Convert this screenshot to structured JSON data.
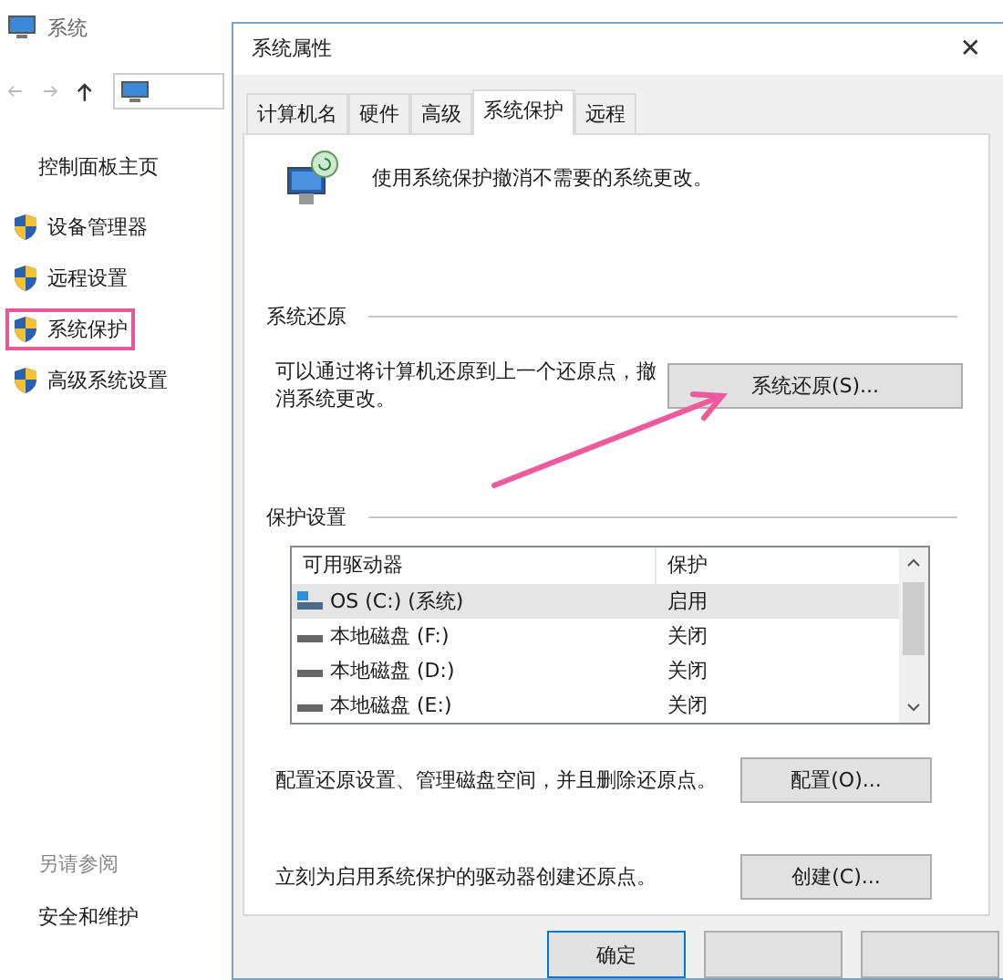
{
  "explorer": {
    "title": "系统",
    "home_link": "控制面板主页",
    "items": [
      {
        "label": "设备管理器",
        "highlighted": false
      },
      {
        "label": "远程设置",
        "highlighted": false
      },
      {
        "label": "系统保护",
        "highlighted": true
      },
      {
        "label": "高级系统设置",
        "highlighted": false
      }
    ],
    "see_also": {
      "heading": "另请参阅",
      "link": "安全和维护"
    }
  },
  "dialog": {
    "title": "系统属性",
    "close": "✕",
    "tabs": [
      {
        "label": "计算机名",
        "selected": false
      },
      {
        "label": "硬件",
        "selected": false
      },
      {
        "label": "高级",
        "selected": false
      },
      {
        "label": "系统保护",
        "selected": true
      },
      {
        "label": "远程",
        "selected": false
      }
    ],
    "intro": "使用系统保护撤消不需要的系统更改。",
    "restore": {
      "heading": "系统还原",
      "text": "可以通过将计算机还原到上一个还原点，撤消系统更改。",
      "button": "系统还原(S)..."
    },
    "protection": {
      "heading": "保护设置",
      "columns": [
        "可用驱动器",
        "保护"
      ],
      "rows": [
        {
          "drive": "OS (C:) (系统)",
          "protection": "启用",
          "kind": "system",
          "selected": true
        },
        {
          "drive": "本地磁盘 (F:)",
          "protection": "关闭",
          "kind": "local",
          "selected": false
        },
        {
          "drive": "本地磁盘 (D:)",
          "protection": "关闭",
          "kind": "local",
          "selected": false
        },
        {
          "drive": "本地磁盘 (E:)",
          "protection": "关闭",
          "kind": "local",
          "selected": false
        }
      ],
      "configure_text": "配置还原设置、管理磁盘空间，并且删除还原点。",
      "configure_button": "配置(O)...",
      "create_text": "立刻为启用系统保护的驱动器创建还原点。",
      "create_button": "创建(C)..."
    },
    "ok_button": "确定"
  }
}
